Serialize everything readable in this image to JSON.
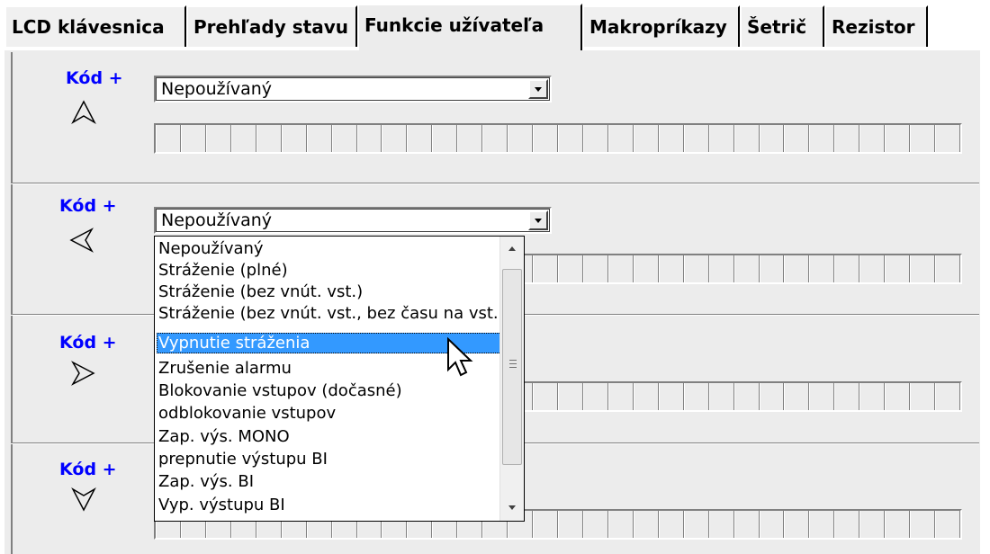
{
  "tabs": [
    {
      "label": "LCD klávesnica",
      "active": false
    },
    {
      "label": "Prehľady stavu",
      "active": false
    },
    {
      "label": "Funkcie užívateľa",
      "active": true
    },
    {
      "label": "Makropríkazy",
      "active": false
    },
    {
      "label": "Šetrič",
      "active": false
    },
    {
      "label": "Rezistor",
      "active": false
    }
  ],
  "rows": [
    {
      "code_label": "Kód +",
      "arrow_icon": "arrow-up-icon",
      "selected": "Nepoužívaný"
    },
    {
      "code_label": "Kód +",
      "arrow_icon": "arrow-left-icon",
      "selected": "Nepoužívaný"
    },
    {
      "code_label": "Kód +",
      "arrow_icon": "arrow-right-icon",
      "selected": ""
    },
    {
      "code_label": "Kód +",
      "arrow_icon": "arrow-down-icon",
      "selected": ""
    }
  ],
  "dropdown": {
    "items": [
      "Nepoužívaný",
      "Stráženie (plné)",
      "Stráženie (bez vnút. vst.)",
      "Stráženie (bez vnút. vst., bez času na vst.",
      "Vypnutie stráženia",
      "Zrušenie alarmu",
      "Blokovanie vstupov (dočasné)",
      "odblokovanie vstupov",
      "Zap. výs. MONO",
      "prepnutie výstupu BI",
      "Zap. výs. BI",
      "Vyp. výstupu BI"
    ],
    "highlighted_index": 4
  },
  "colors": {
    "label_blue": "#0000ff",
    "highlight": "#3399ff",
    "face": "#ececec"
  },
  "cursor_icon": "mouse-pointer-icon"
}
